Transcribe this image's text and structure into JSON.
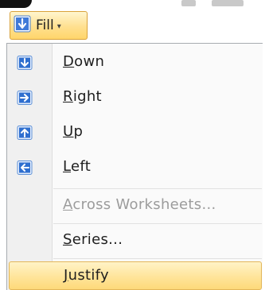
{
  "fill_button": {
    "label": "Fill",
    "caret": "▾",
    "icon": "fill-down-icon"
  },
  "menu": {
    "items": [
      {
        "key": "down",
        "accel": "D",
        "rest": "own",
        "icon": "arrow-down-icon",
        "enabled": true
      },
      {
        "key": "right",
        "accel": "R",
        "rest": "ight",
        "icon": "arrow-right-icon",
        "enabled": true
      },
      {
        "key": "up",
        "accel": "U",
        "rest": "p",
        "icon": "arrow-up-icon",
        "enabled": true
      },
      {
        "key": "left",
        "accel": "L",
        "rest": "eft",
        "icon": "arrow-left-icon",
        "enabled": true
      },
      {
        "key": "across-worksheets",
        "accel": "A",
        "rest": "cross Worksheets...",
        "enabled": false
      },
      {
        "key": "series",
        "accel": "S",
        "rest": "eries...",
        "enabled": true
      },
      {
        "key": "justify",
        "accel": "J",
        "rest": "ustify",
        "enabled": true,
        "highlighted": true
      }
    ]
  },
  "colors": {
    "highlight": "#ffe396",
    "icon_blue": "#2f6fcf",
    "disabled_text": "#9c9c9c"
  }
}
